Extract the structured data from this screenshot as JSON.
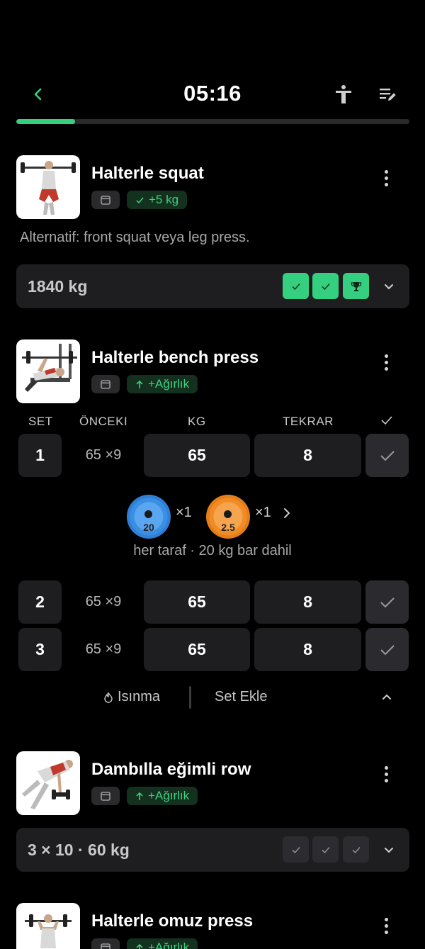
{
  "header": {
    "timer": "05:16",
    "progress": 0.15
  },
  "exercises": [
    {
      "title": "Halterle squat",
      "badge": "+5 kg",
      "badge_icon": "check-icon",
      "note": "Alternatif: front squat veya leg press.",
      "summary": "1840 kg",
      "sets_status": [
        "done",
        "done",
        "trophy"
      ]
    },
    {
      "title": "Halterle bench press",
      "badge": "+Ağırlık",
      "badge_icon": "arrow-up-icon",
      "columns": {
        "set": "SET",
        "previous": "ÖNCEKI",
        "kg": "KG",
        "reps": "TEKRAR"
      },
      "sets": [
        {
          "num": "1",
          "prev": "65 ×9",
          "kg": "65",
          "reps": "8"
        },
        {
          "num": "2",
          "prev": "65 ×9",
          "kg": "65",
          "reps": "8"
        },
        {
          "num": "3",
          "prev": "65 ×9",
          "kg": "65",
          "reps": "8"
        }
      ],
      "plates": [
        {
          "weight": "20",
          "count": "×1",
          "color": "#3a8ee4"
        },
        {
          "weight": "2.5",
          "count": "×1",
          "color": "#f08b26"
        }
      ],
      "plate_note": "her taraf · 20 kg bar dahil",
      "warmup_label": "Isınma",
      "add_set_label": "Set Ekle"
    },
    {
      "title": "Dambılla eğimli row",
      "badge": "+Ağırlık",
      "badge_icon": "arrow-up-icon",
      "summary": "3 × 10 · 60 kg",
      "sets_status": [
        "pending",
        "pending",
        "pending"
      ]
    },
    {
      "title": "Halterle omuz press",
      "badge": "+Ağırlık",
      "badge_icon": "arrow-up-icon"
    }
  ],
  "colors": {
    "accent": "#35d07f",
    "card": "#1e1e21",
    "background": "#000000"
  }
}
